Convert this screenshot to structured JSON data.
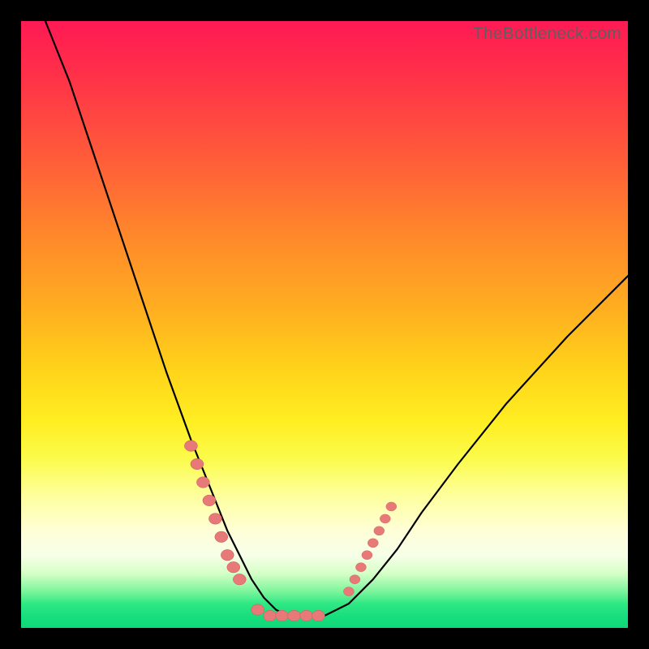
{
  "watermark": "TheBottleneck.com",
  "chart_data": {
    "type": "line",
    "title": "",
    "xlabel": "",
    "ylabel": "",
    "xlim": [
      0,
      100
    ],
    "ylim": [
      0,
      100
    ],
    "grid": false,
    "legend": false,
    "background_gradient": {
      "direction": "vertical",
      "stops": [
        {
          "pos": 0,
          "color": "#ff1a55"
        },
        {
          "pos": 36,
          "color": "#ff8a2a"
        },
        {
          "pos": 66,
          "color": "#ffee22"
        },
        {
          "pos": 88,
          "color": "#f7ffe8"
        },
        {
          "pos": 100,
          "color": "#0fd878"
        }
      ]
    },
    "series": [
      {
        "name": "bottleneck-curve",
        "x": [
          4,
          8,
          12,
          16,
          20,
          24,
          28,
          30,
          32,
          34,
          36,
          38,
          40,
          42,
          44,
          46,
          50,
          54,
          58,
          62,
          66,
          72,
          80,
          90,
          100
        ],
        "y": [
          100,
          90,
          78,
          66,
          54,
          42,
          31,
          26,
          21,
          16,
          12,
          8,
          5,
          3,
          2,
          2,
          2,
          4,
          8,
          13,
          19,
          27,
          37,
          48,
          58
        ]
      }
    ],
    "markers": {
      "name": "highlight-points",
      "color": "#e77a78",
      "cluster_left": [
        {
          "x": 28,
          "y": 30
        },
        {
          "x": 29,
          "y": 27
        },
        {
          "x": 30,
          "y": 24
        },
        {
          "x": 31,
          "y": 21
        },
        {
          "x": 32,
          "y": 18
        },
        {
          "x": 33,
          "y": 15
        },
        {
          "x": 34,
          "y": 12
        },
        {
          "x": 35,
          "y": 10
        },
        {
          "x": 36,
          "y": 8
        }
      ],
      "cluster_bottom": [
        {
          "x": 39,
          "y": 3
        },
        {
          "x": 41,
          "y": 2
        },
        {
          "x": 43,
          "y": 2
        },
        {
          "x": 45,
          "y": 2
        },
        {
          "x": 47,
          "y": 2
        },
        {
          "x": 49,
          "y": 2
        }
      ],
      "cluster_right": [
        {
          "x": 54,
          "y": 6
        },
        {
          "x": 55,
          "y": 8
        },
        {
          "x": 56,
          "y": 10
        },
        {
          "x": 57,
          "y": 12
        },
        {
          "x": 58,
          "y": 14
        },
        {
          "x": 59,
          "y": 16
        },
        {
          "x": 60,
          "y": 18
        },
        {
          "x": 61,
          "y": 20
        }
      ]
    }
  }
}
